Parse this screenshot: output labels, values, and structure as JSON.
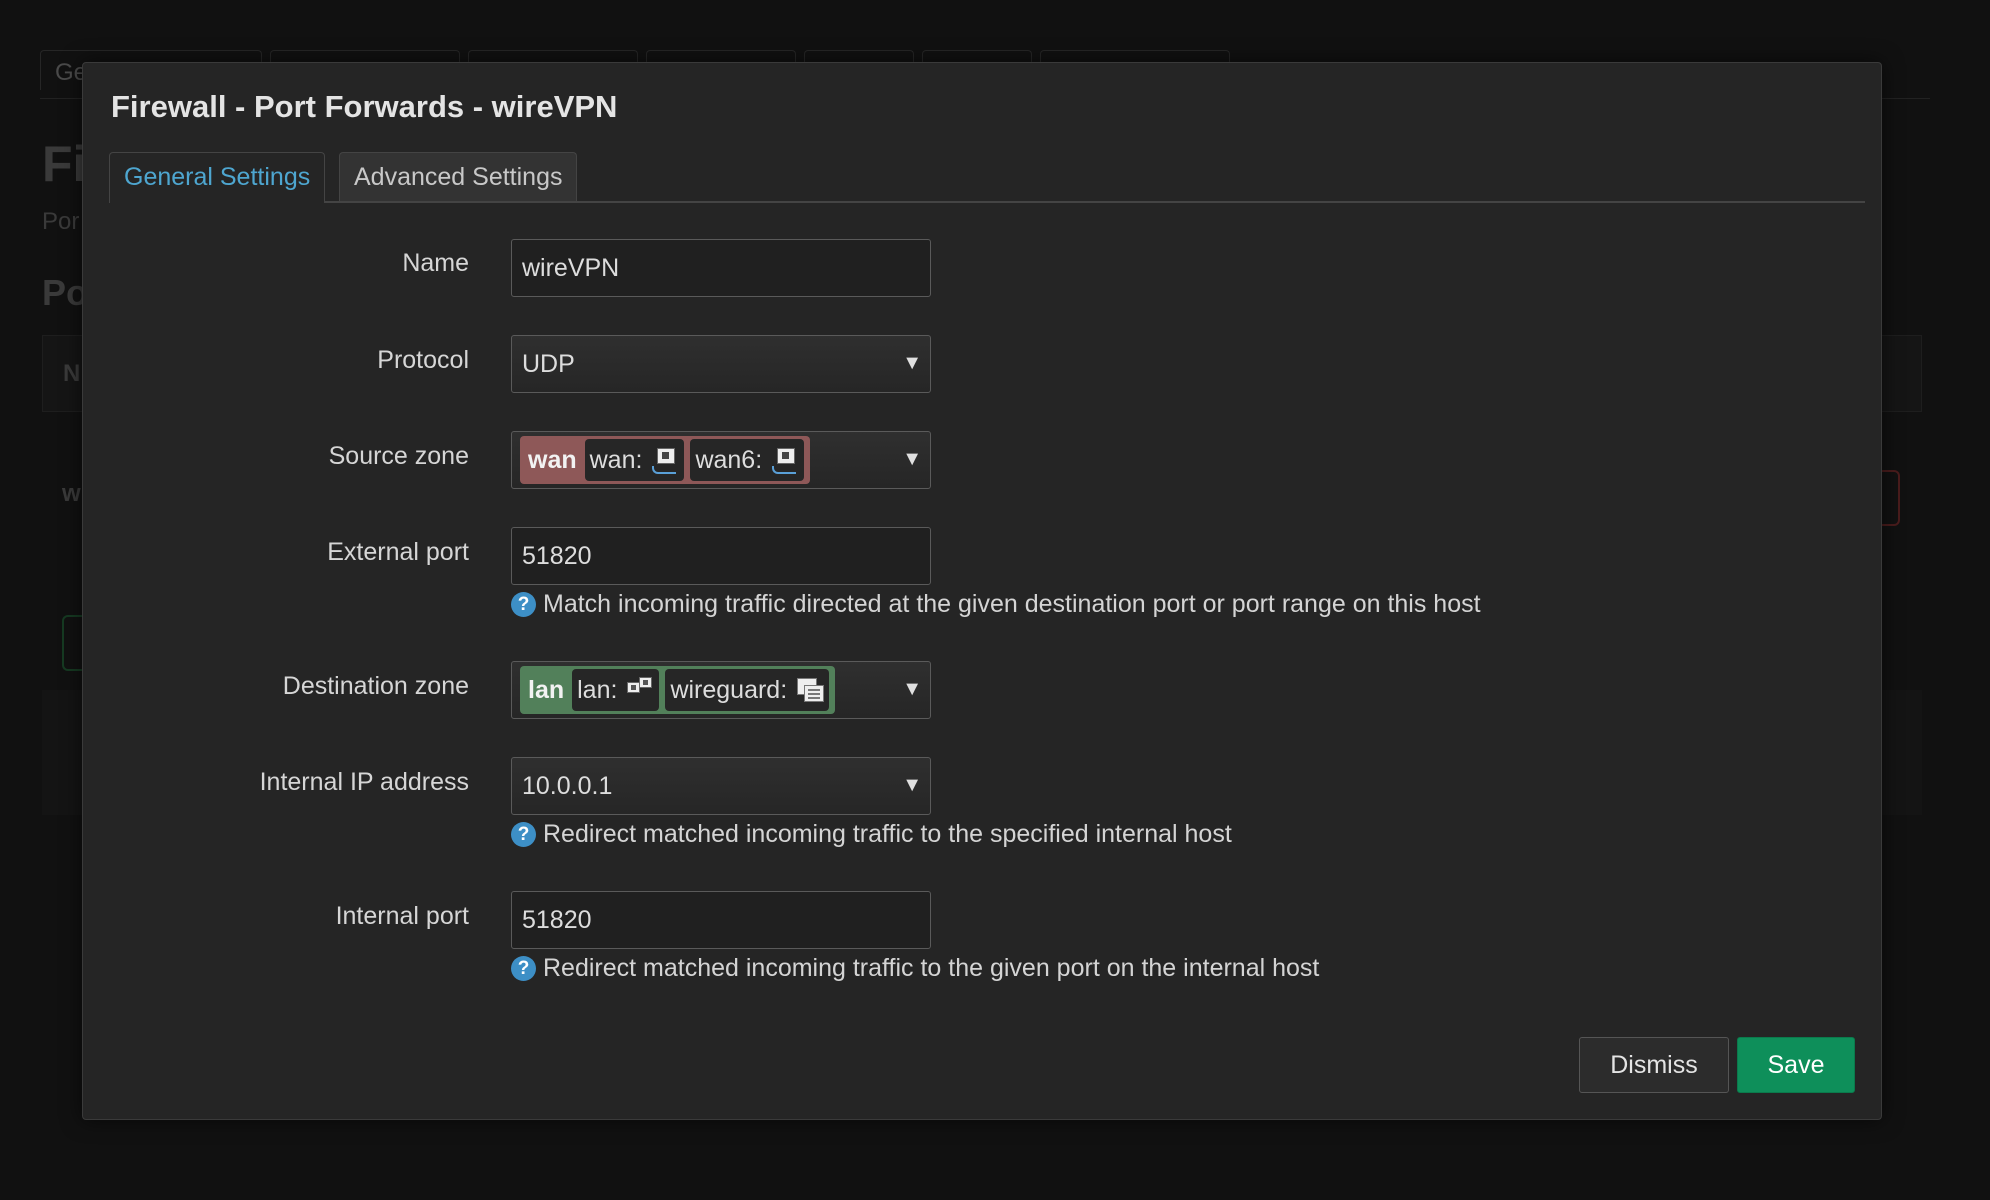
{
  "background": {
    "tabs": [
      "Ge",
      "",
      "",
      "",
      "",
      "",
      ""
    ],
    "title": "Fi",
    "subtitle": "Por",
    "section": "Po",
    "table_header": "N",
    "row_label": "w"
  },
  "modal": {
    "title": "Firewall - Port Forwards - wireVPN",
    "tabs": [
      {
        "label": "General Settings",
        "active": true
      },
      {
        "label": "Advanced Settings",
        "active": false
      }
    ],
    "fields": {
      "name": {
        "label": "Name",
        "value": "wireVPN"
      },
      "protocol": {
        "label": "Protocol",
        "value": "UDP"
      },
      "source_zone": {
        "label": "Source zone",
        "zone": "wan",
        "zone_color": "#8e5858",
        "interfaces": [
          {
            "name": "wan:",
            "icon": "ethernet-port-icon"
          },
          {
            "name": "wan6:",
            "icon": "ethernet-port-icon"
          }
        ]
      },
      "external_port": {
        "label": "External port",
        "value": "51820",
        "hint": "Match incoming traffic directed at the given destination port or port range on this host"
      },
      "destination_zone": {
        "label": "Destination zone",
        "zone": "lan",
        "zone_color": "#52805a",
        "interfaces": [
          {
            "name": "lan:",
            "icon": "network-bridge-icon"
          },
          {
            "name": "wireguard:",
            "icon": "tunnel-icon"
          }
        ]
      },
      "internal_ip": {
        "label": "Internal IP address",
        "value": "10.0.0.1",
        "hint": "Redirect matched incoming traffic to the specified internal host"
      },
      "internal_port": {
        "label": "Internal port",
        "value": "51820",
        "hint": "Redirect matched incoming traffic to the given port on the internal host"
      }
    },
    "buttons": {
      "dismiss": "Dismiss",
      "save": "Save"
    },
    "colors": {
      "accent": "#4ea6d0",
      "save": "#0e8f5a"
    }
  }
}
